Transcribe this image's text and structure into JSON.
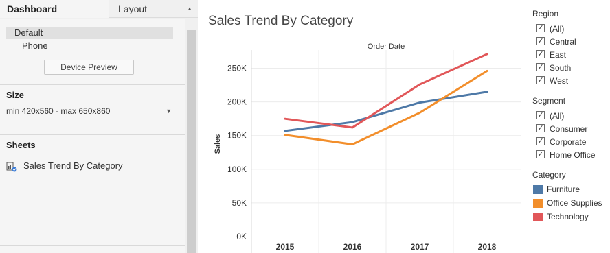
{
  "tabs": {
    "dashboard": "Dashboard",
    "layout": "Layout"
  },
  "device": {
    "default": "Default",
    "phone": "Phone",
    "preview_button": "Device Preview"
  },
  "size": {
    "title": "Size",
    "value": "min 420x560 - max 650x860"
  },
  "sheets": {
    "title": "Sheets",
    "items": [
      "Sales Trend By Category"
    ]
  },
  "dashboard_title": "Sales Trend By Category",
  "filters": {
    "region": {
      "title": "Region",
      "options": [
        "(All)",
        "Central",
        "East",
        "South",
        "West"
      ]
    },
    "segment": {
      "title": "Segment",
      "options": [
        "(All)",
        "Consumer",
        "Corporate",
        "Home Office"
      ]
    }
  },
  "legend": {
    "title": "Category",
    "items": [
      {
        "label": "Furniture",
        "color": "#4e79a7"
      },
      {
        "label": "Office Supplies",
        "color": "#f28e2b"
      },
      {
        "label": "Technology",
        "color": "#e15759"
      }
    ]
  },
  "chart_data": {
    "type": "line",
    "title": "",
    "xlabel": "Order Date",
    "ylabel": "Sales",
    "x": [
      "2015",
      "2016",
      "2017",
      "2018"
    ],
    "ylim": [
      0,
      275000
    ],
    "yticks": [
      0,
      50000,
      100000,
      150000,
      200000,
      250000
    ],
    "ytick_labels": [
      "0K",
      "50K",
      "100K",
      "150K",
      "200K",
      "250K"
    ],
    "grid": true,
    "series": [
      {
        "name": "Furniture",
        "color": "#4e79a7",
        "values": [
          157000,
          170000,
          199000,
          215000
        ]
      },
      {
        "name": "Office Supplies",
        "color": "#f28e2b",
        "values": [
          151000,
          137000,
          184000,
          246000
        ]
      },
      {
        "name": "Technology",
        "color": "#e15759",
        "values": [
          175000,
          162000,
          226000,
          271000
        ]
      }
    ]
  }
}
